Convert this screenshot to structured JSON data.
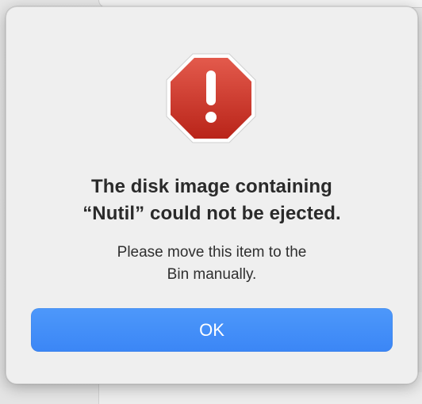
{
  "alert": {
    "icon": "stop-exclamation-icon",
    "title_line_1": "The disk image containing",
    "title_line_2": "“Nutil” could not be ejected.",
    "message_line_1": "Please move this item to the",
    "message_line_2": "Bin manually.",
    "ok_label": "OK"
  },
  "colors": {
    "accent": "#3b86f6",
    "icon_red": "#d23b2f",
    "dialog_bg": "#efefef"
  }
}
